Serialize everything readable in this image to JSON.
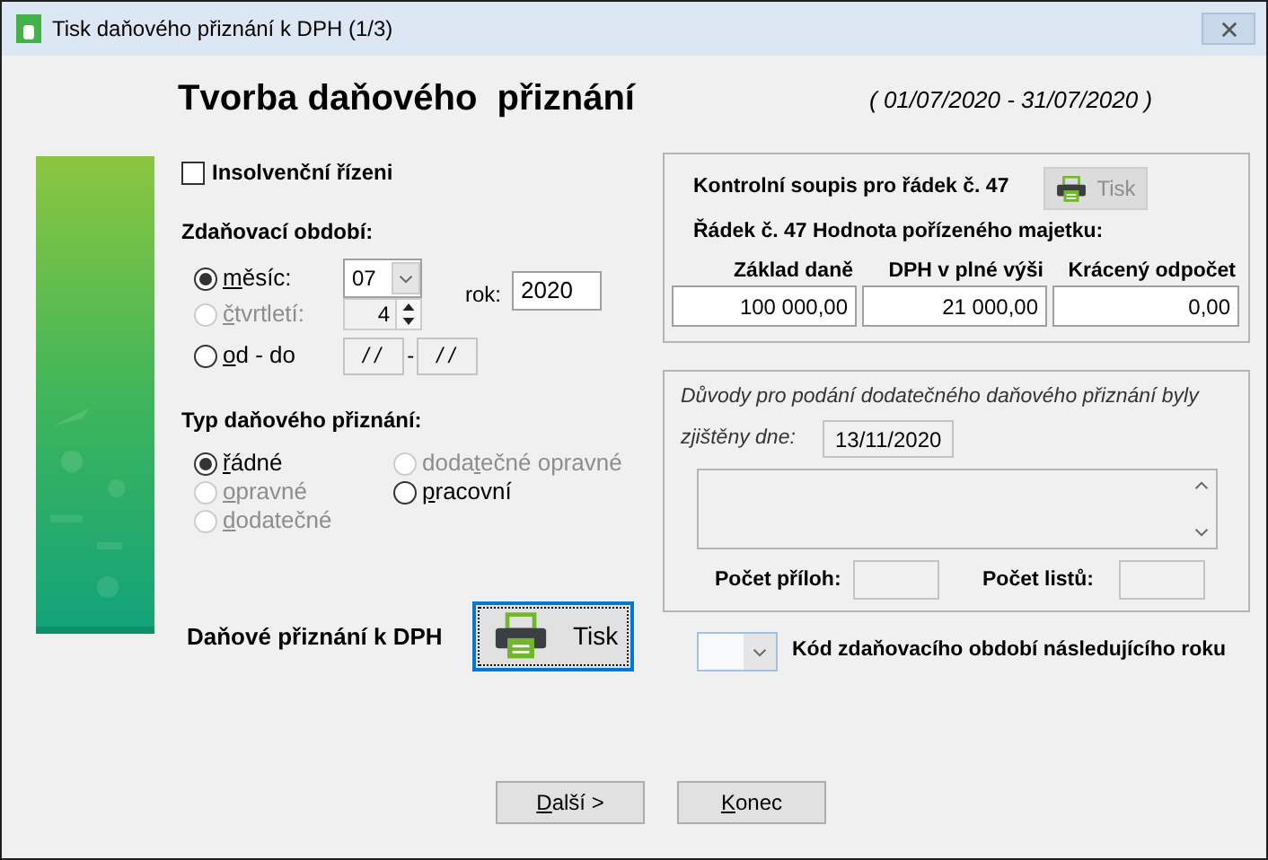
{
  "window": {
    "title": "Tisk daňového přiznání k DPH (1/3)"
  },
  "heading": "Tvorba daňového  přiznání",
  "period_range": "( 01/07/2020 - 31/07/2020 )",
  "insolvency": {
    "label": "Insolvenční řízeni",
    "checked": false
  },
  "tax_period": {
    "label": "Zdaňovací období:",
    "options": [
      {
        "kind": "month",
        "label": "měsíc:",
        "selected": true,
        "disabled": false,
        "value": "07"
      },
      {
        "kind": "quarter",
        "label": "čtvrtletí:",
        "selected": false,
        "disabled": true,
        "value": "4"
      },
      {
        "kind": "range",
        "label": "od - do",
        "selected": false,
        "disabled": false,
        "from": "/ /",
        "separator": "-",
        "to": "/ /"
      }
    ],
    "year_label": "rok:",
    "year": "2020"
  },
  "return_type": {
    "label": "Typ daňového přiznání:",
    "options": [
      {
        "label": "řádné",
        "selected": true,
        "disabled": false
      },
      {
        "label": "opravné",
        "selected": false,
        "disabled": true
      },
      {
        "label": "dodatečné",
        "selected": false,
        "disabled": true
      },
      {
        "label": "dodatečné opravné",
        "selected": false,
        "disabled": true
      },
      {
        "label": "pracovní",
        "selected": false,
        "disabled": false
      }
    ]
  },
  "print_return": {
    "label": "Daňové přiznání k DPH",
    "button": "Tisk",
    "focused": true
  },
  "control_list": {
    "title": "Kontrolní soupis pro řádek č. 47",
    "button": "Tisk",
    "button_disabled": true,
    "row_label": "Řádek č. 47 Hodnota pořízeného majetku:",
    "columns": [
      {
        "header": "Základ daně",
        "value": "100 000,00"
      },
      {
        "header": "DPH v plné výši",
        "value": "21 000,00"
      },
      {
        "header": "Krácený odpočet",
        "value": "0,00"
      }
    ]
  },
  "supplementary": {
    "reasons_label": "Důvody pro podání dodatečného daňového přiznání byly",
    "found_label": "zjištěny dne:",
    "found_date": "13/11/2020",
    "attachments_label": "Počet příloh:",
    "sheets_label": "Počet listů:"
  },
  "next_year_code": {
    "label": "Kód zdaňovacího období následujícího roku"
  },
  "buttons": [
    {
      "label": "Další >"
    },
    {
      "label": "Konec"
    }
  ]
}
